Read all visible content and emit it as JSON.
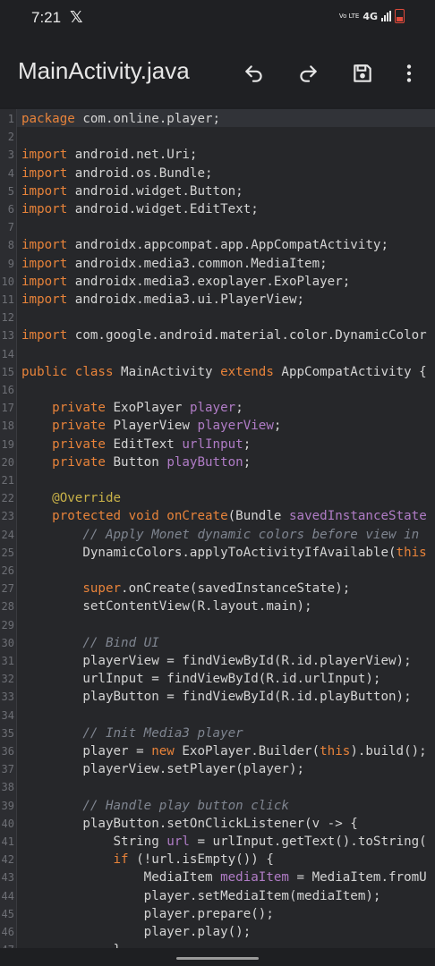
{
  "status_bar": {
    "time": "7:21",
    "x_glyph": "𝕏",
    "volte": "Vo LTE",
    "network": "4G",
    "battery_color": "#e04a3b"
  },
  "app_bar": {
    "title": "MainActivity.java",
    "icons": [
      "undo-icon",
      "redo-icon",
      "save-icon",
      "more-vert-icon"
    ]
  },
  "editor": {
    "lines": [
      {
        "n": "1",
        "tokens": [
          {
            "t": "kw",
            "v": "package"
          },
          {
            "t": "plain",
            "v": " com.online.player;"
          }
        ]
      },
      {
        "n": "2",
        "tokens": []
      },
      {
        "n": "3",
        "tokens": [
          {
            "t": "kw",
            "v": "import"
          },
          {
            "t": "plain",
            "v": " android.net.Uri;"
          }
        ]
      },
      {
        "n": "4",
        "tokens": [
          {
            "t": "kw",
            "v": "import"
          },
          {
            "t": "plain",
            "v": " android.os.Bundle;"
          }
        ]
      },
      {
        "n": "5",
        "tokens": [
          {
            "t": "kw",
            "v": "import"
          },
          {
            "t": "plain",
            "v": " android.widget.Button;"
          }
        ]
      },
      {
        "n": "6",
        "tokens": [
          {
            "t": "kw",
            "v": "import"
          },
          {
            "t": "plain",
            "v": " android.widget.EditText;"
          }
        ]
      },
      {
        "n": "7",
        "tokens": []
      },
      {
        "n": "8",
        "tokens": [
          {
            "t": "kw",
            "v": "import"
          },
          {
            "t": "plain",
            "v": " androidx.appcompat.app.AppCompatActivity;"
          }
        ]
      },
      {
        "n": "9",
        "tokens": [
          {
            "t": "kw",
            "v": "import"
          },
          {
            "t": "plain",
            "v": " androidx.media3.common.MediaItem;"
          }
        ]
      },
      {
        "n": "10",
        "tokens": [
          {
            "t": "kw",
            "v": "import"
          },
          {
            "t": "plain",
            "v": " androidx.media3.exoplayer.ExoPlayer;"
          }
        ]
      },
      {
        "n": "11",
        "tokens": [
          {
            "t": "kw",
            "v": "import"
          },
          {
            "t": "plain",
            "v": " androidx.media3.ui.PlayerView;"
          }
        ]
      },
      {
        "n": "12",
        "tokens": []
      },
      {
        "n": "13",
        "tokens": [
          {
            "t": "kw",
            "v": "import"
          },
          {
            "t": "plain",
            "v": " com.google.android.material.color.DynamicColor"
          }
        ]
      },
      {
        "n": "14",
        "tokens": []
      },
      {
        "n": "15",
        "tokens": [
          {
            "t": "kw",
            "v": "public class"
          },
          {
            "t": "plain",
            "v": " MainActivity "
          },
          {
            "t": "kw",
            "v": "extends"
          },
          {
            "t": "plain",
            "v": " AppCompatActivity {"
          }
        ]
      },
      {
        "n": "16",
        "tokens": []
      },
      {
        "n": "17",
        "tokens": [
          {
            "t": "kw",
            "v": "    private"
          },
          {
            "t": "plain",
            "v": " ExoPlayer "
          },
          {
            "t": "fld",
            "v": "player"
          },
          {
            "t": "plain",
            "v": ";"
          }
        ]
      },
      {
        "n": "18",
        "tokens": [
          {
            "t": "kw",
            "v": "    private"
          },
          {
            "t": "plain",
            "v": " PlayerView "
          },
          {
            "t": "fld",
            "v": "playerView"
          },
          {
            "t": "plain",
            "v": ";"
          }
        ]
      },
      {
        "n": "19",
        "tokens": [
          {
            "t": "kw",
            "v": "    private"
          },
          {
            "t": "plain",
            "v": " EditText "
          },
          {
            "t": "fld",
            "v": "urlInput"
          },
          {
            "t": "plain",
            "v": ";"
          }
        ]
      },
      {
        "n": "20",
        "tokens": [
          {
            "t": "kw",
            "v": "    private"
          },
          {
            "t": "plain",
            "v": " Button "
          },
          {
            "t": "fld",
            "v": "playButton"
          },
          {
            "t": "plain",
            "v": ";"
          }
        ]
      },
      {
        "n": "21",
        "tokens": []
      },
      {
        "n": "22",
        "tokens": [
          {
            "t": "plain",
            "v": "    "
          },
          {
            "t": "ann",
            "v": "@Override"
          }
        ]
      },
      {
        "n": "23",
        "tokens": [
          {
            "t": "kw",
            "v": "    protected void"
          },
          {
            "t": "plain",
            "v": " "
          },
          {
            "t": "kw",
            "v": "onCreate"
          },
          {
            "t": "plain",
            "v": "(Bundle "
          },
          {
            "t": "fld",
            "v": "savedInstanceState"
          }
        ]
      },
      {
        "n": "24",
        "tokens": [
          {
            "t": "cm",
            "v": "        // Apply Monet dynamic colors before view in"
          }
        ]
      },
      {
        "n": "25",
        "tokens": [
          {
            "t": "plain",
            "v": "        DynamicColors.applyToActivityIfAvailable("
          },
          {
            "t": "kw",
            "v": "this"
          }
        ]
      },
      {
        "n": "26",
        "tokens": []
      },
      {
        "n": "27",
        "tokens": [
          {
            "t": "kw",
            "v": "        super"
          },
          {
            "t": "plain",
            "v": ".onCreate(savedInstanceState);"
          }
        ]
      },
      {
        "n": "28",
        "tokens": [
          {
            "t": "plain",
            "v": "        setContentView(R.layout.main);"
          }
        ]
      },
      {
        "n": "29",
        "tokens": []
      },
      {
        "n": "30",
        "tokens": [
          {
            "t": "cm",
            "v": "        // Bind UI"
          }
        ]
      },
      {
        "n": "31",
        "tokens": [
          {
            "t": "plain",
            "v": "        playerView = findViewById(R.id.playerView);"
          }
        ]
      },
      {
        "n": "32",
        "tokens": [
          {
            "t": "plain",
            "v": "        urlInput = findViewById(R.id.urlInput);"
          }
        ]
      },
      {
        "n": "33",
        "tokens": [
          {
            "t": "plain",
            "v": "        playButton = findViewById(R.id.playButton);"
          }
        ]
      },
      {
        "n": "34",
        "tokens": []
      },
      {
        "n": "35",
        "tokens": [
          {
            "t": "cm",
            "v": "        // Init Media3 player"
          }
        ]
      },
      {
        "n": "36",
        "tokens": [
          {
            "t": "plain",
            "v": "        player = "
          },
          {
            "t": "kw",
            "v": "new"
          },
          {
            "t": "plain",
            "v": " ExoPlayer.Builder("
          },
          {
            "t": "kw",
            "v": "this"
          },
          {
            "t": "plain",
            "v": ").build();"
          }
        ]
      },
      {
        "n": "37",
        "tokens": [
          {
            "t": "plain",
            "v": "        playerView.setPlayer(player);"
          }
        ]
      },
      {
        "n": "38",
        "tokens": []
      },
      {
        "n": "39",
        "tokens": [
          {
            "t": "cm",
            "v": "        // Handle play button click"
          }
        ]
      },
      {
        "n": "40",
        "tokens": [
          {
            "t": "plain",
            "v": "        playButton.setOnClickListener(v -> {"
          }
        ]
      },
      {
        "n": "41",
        "tokens": [
          {
            "t": "plain",
            "v": "            String "
          },
          {
            "t": "fld",
            "v": "url"
          },
          {
            "t": "plain",
            "v": " = urlInput.getText().toString("
          }
        ]
      },
      {
        "n": "42",
        "tokens": [
          {
            "t": "kw",
            "v": "            if"
          },
          {
            "t": "plain",
            "v": " (!url.isEmpty()) {"
          }
        ]
      },
      {
        "n": "43",
        "tokens": [
          {
            "t": "plain",
            "v": "                MediaItem "
          },
          {
            "t": "fld",
            "v": "mediaItem"
          },
          {
            "t": "plain",
            "v": " = MediaItem.fromU"
          }
        ]
      },
      {
        "n": "44",
        "tokens": [
          {
            "t": "plain",
            "v": "                player.setMediaItem(mediaItem);"
          }
        ]
      },
      {
        "n": "45",
        "tokens": [
          {
            "t": "plain",
            "v": "                player.prepare();"
          }
        ]
      },
      {
        "n": "46",
        "tokens": [
          {
            "t": "plain",
            "v": "                player.play();"
          }
        ]
      },
      {
        "n": "47",
        "tokens": [
          {
            "t": "plain",
            "v": "            }"
          }
        ]
      }
    ]
  },
  "colors": {
    "keyword": "#e8833a",
    "field": "#b07cc6",
    "comment": "#7f8590",
    "annotation": "#c9b248",
    "text": "#d4d4d4"
  }
}
